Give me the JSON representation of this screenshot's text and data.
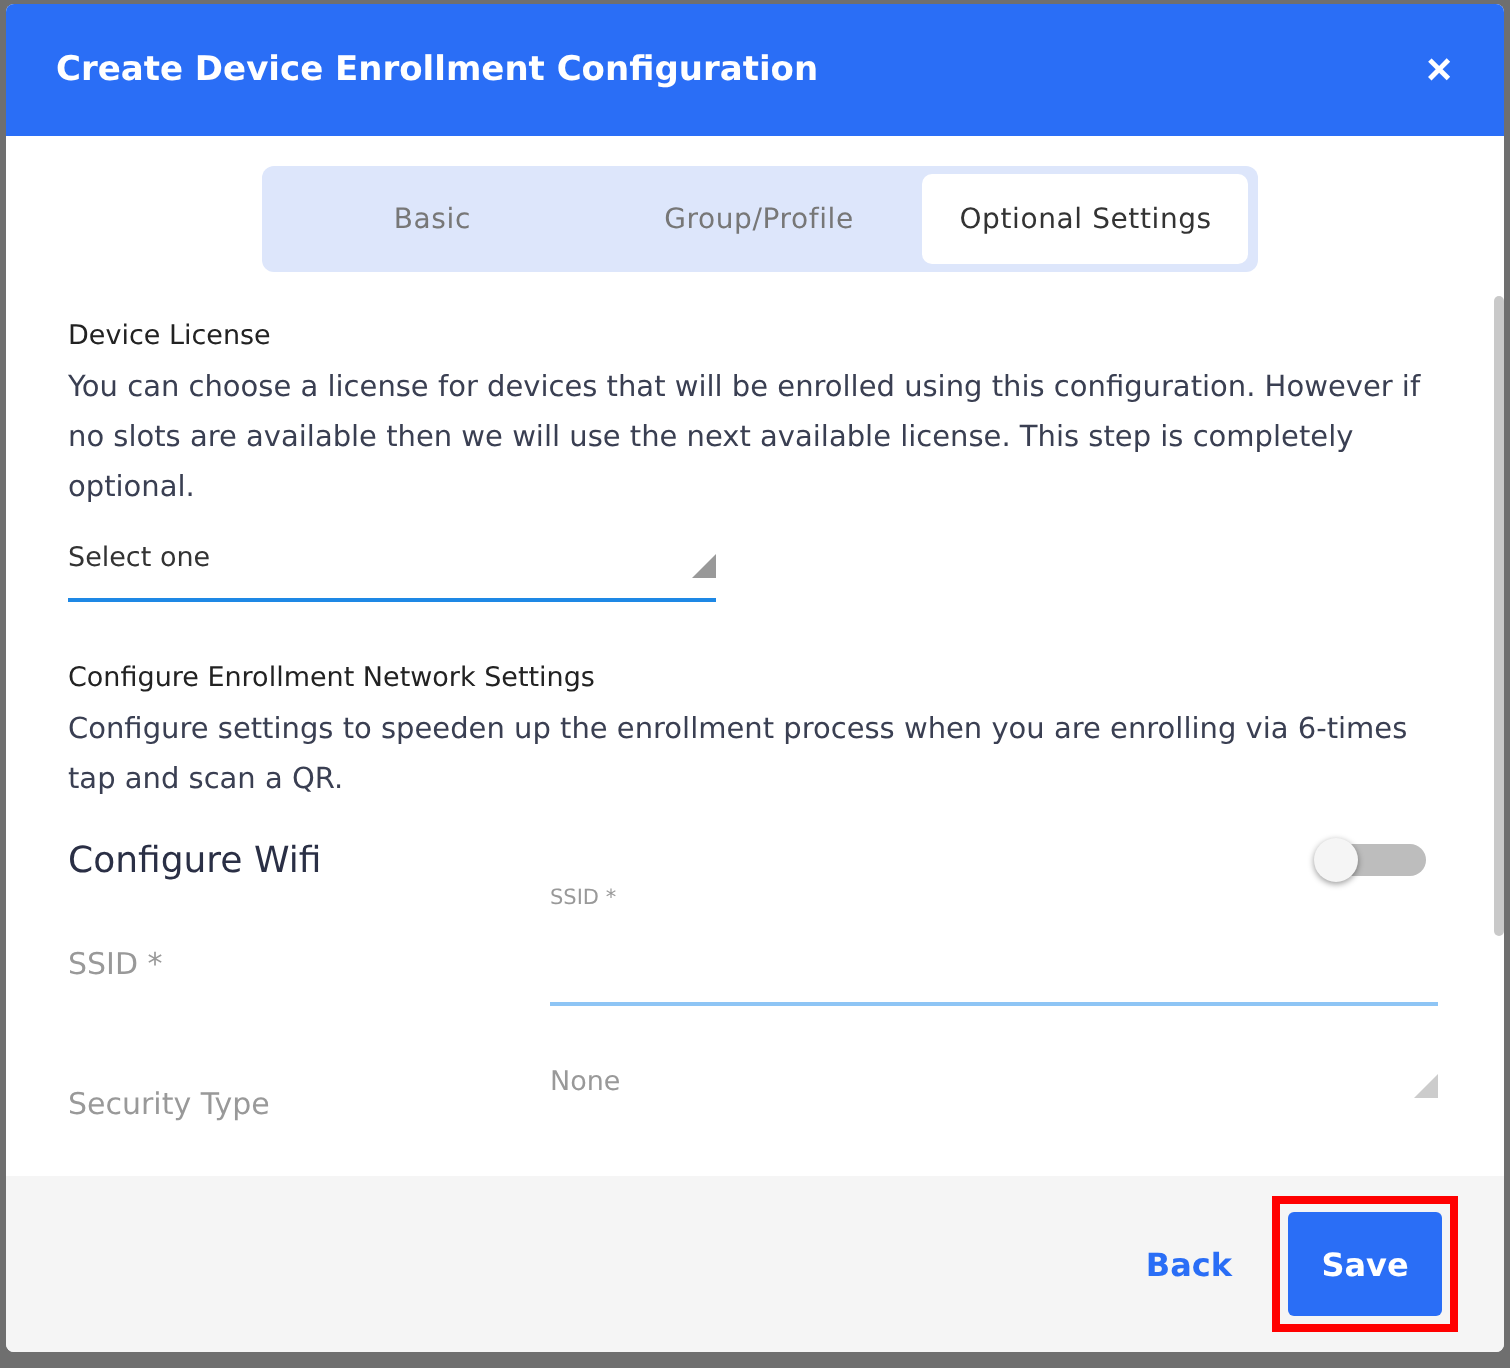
{
  "dialog": {
    "title": "Create Device Enrollment Configuration",
    "close": "×"
  },
  "tabs": [
    {
      "label": "Basic",
      "selected": false
    },
    {
      "label": "Group/Profile",
      "selected": false
    },
    {
      "label": "Optional Settings",
      "selected": true
    }
  ],
  "license": {
    "heading": "Device License",
    "description": "You can choose a license for devices that will be enrolled using this configuration. However if no slots are available then we will use the next available license. This step is completely optional.",
    "select": {
      "value": "Select one"
    }
  },
  "network": {
    "heading": "Configure Enrollment Network Settings",
    "description": "Configure settings to speeden up the enrollment process when you are enrolling via 6-times tap and scan a QR."
  },
  "wifi": {
    "label": "Configure Wifi",
    "on": false,
    "fields": [
      {
        "kind": "text",
        "label": "SSID *",
        "floating_label": "SSID *"
      },
      {
        "kind": "select",
        "label": "Security Type",
        "value": "None"
      }
    ]
  },
  "footer": {
    "buttons": [
      {
        "kind": "link",
        "label": "Back",
        "highlighted": false
      },
      {
        "kind": "primary",
        "label": "Save",
        "highlighted": true
      }
    ]
  }
}
